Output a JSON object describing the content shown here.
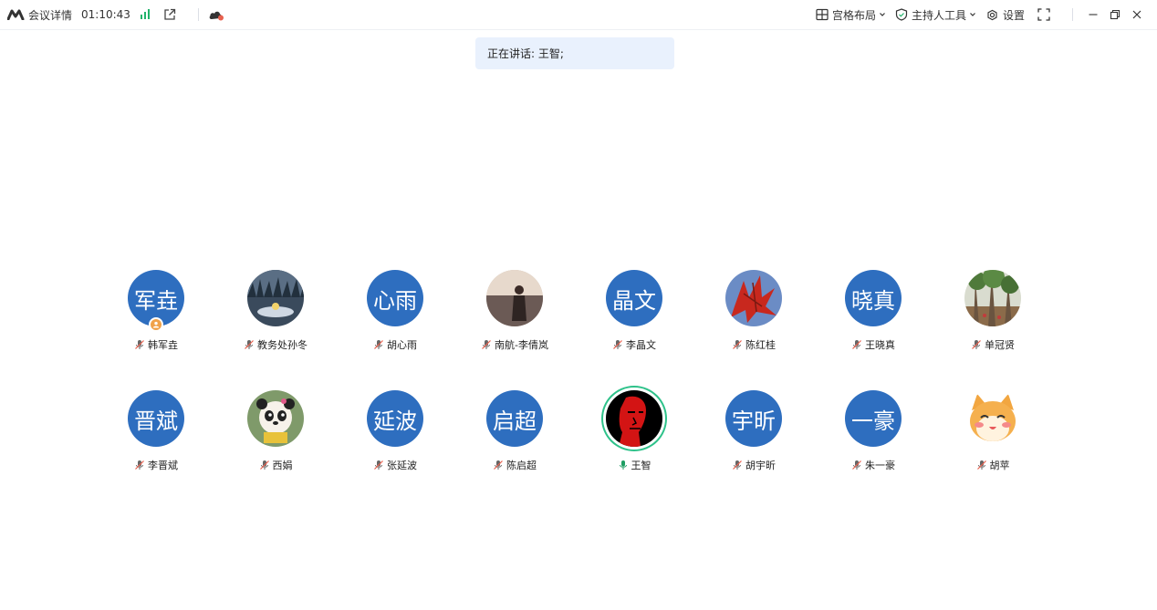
{
  "topbar": {
    "meeting_details": "会议详情",
    "timer": "01:10:43",
    "layout_label": "宫格布局",
    "host_tools_label": "主持人工具",
    "settings_label": "设置"
  },
  "speaking": {
    "text": "正在讲话: 王智;"
  },
  "participants": [
    {
      "name": "韩军垚",
      "avatar_text": "军垚"
    },
    {
      "name": "教务处孙冬",
      "avatar_text": ""
    },
    {
      "name": "胡心雨",
      "avatar_text": "心雨"
    },
    {
      "name": "南航-李倩岚",
      "avatar_text": ""
    },
    {
      "name": "李晶文",
      "avatar_text": "晶文"
    },
    {
      "name": "陈红桂",
      "avatar_text": ""
    },
    {
      "name": "王晓真",
      "avatar_text": "晓真"
    },
    {
      "name": "单冠贤",
      "avatar_text": ""
    },
    {
      "name": "李晋斌",
      "avatar_text": "晋斌"
    },
    {
      "name": "西娟",
      "avatar_text": ""
    },
    {
      "name": "张延波",
      "avatar_text": "延波"
    },
    {
      "name": "陈启超",
      "avatar_text": "启超"
    },
    {
      "name": "王智",
      "avatar_text": ""
    },
    {
      "name": "胡宇昕",
      "avatar_text": "宇昕"
    },
    {
      "name": "朱一豪",
      "avatar_text": "一豪"
    },
    {
      "name": "胡苹",
      "avatar_text": ""
    }
  ],
  "colors": {
    "avatar_blue": "#2e6ebf",
    "signal_green": "#21b36b",
    "speaking_bg": "#e9f1fd",
    "active_ring": "#2ec28a",
    "host_badge": "#f0a24a"
  }
}
